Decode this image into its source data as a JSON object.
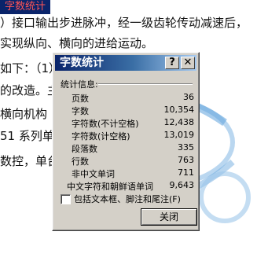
{
  "document": {
    "highlight": "字数统计",
    "lines": [
      "）接口输出步进脉冲，经一级齿轮传动减速后，",
      "实现纵向、横向的进给运动。",
      "如下：（1）纵向进给方",
      "的改造。主                    刀架及反应式步",
      "  横向机构                   （2）电气控制",
      "51 系列单                   的电气控制图",
      "数控，单台                        红，改造"
    ]
  },
  "dialog": {
    "title": "字数统计",
    "help_glyph": "?",
    "close_glyph": "✕",
    "section_label": "统计信息:",
    "stats": [
      {
        "label": "页数",
        "value": "36"
      },
      {
        "label": "字数",
        "value": "10,354"
      },
      {
        "label": "字符数(不计空格)",
        "value": "12,438"
      },
      {
        "label": "字符数(计空格)",
        "value": "13,019"
      },
      {
        "label": "段落数",
        "value": "335"
      },
      {
        "label": "行数",
        "value": "763"
      },
      {
        "label": "非中文单词",
        "value": "711"
      },
      {
        "label": "中文字符和朝鲜语单词",
        "value": "9,643"
      }
    ],
    "checkbox_label": "包括文本框、脚注和尾注(F)",
    "checkbox_checked": false,
    "close_button": "关闭"
  }
}
